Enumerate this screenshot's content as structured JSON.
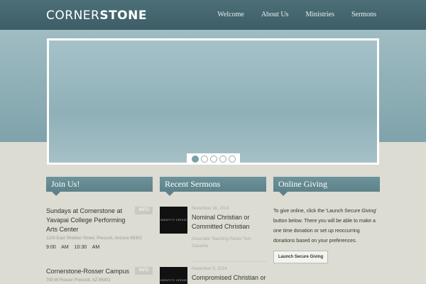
{
  "header": {
    "logo_light": "CORNER",
    "logo_bold": "STONE",
    "nav": [
      "Welcome",
      "About Us",
      "Ministries",
      "Sermons"
    ]
  },
  "slider": {
    "dot_count": 5,
    "active_dot": 1
  },
  "join": {
    "heading": "Join Us!",
    "entries": [
      {
        "title": "Sundays at Cornerstone at Yavapai College Performing Arts Center",
        "info": "INFO",
        "address": "1100 East Sheldon Street, Prescott, Arizona 86301",
        "times": "9:00 AM 10:30 AM"
      },
      {
        "title": "Cornerstone-Rosser Campus",
        "info": "INFO",
        "address": "700 W Rosser Prescott, AZ 86301"
      }
    ]
  },
  "sermons": {
    "heading": "Recent Sermons",
    "items": [
      {
        "thumb_text": "IDENTITY CRISIS",
        "date": "November 16, 2014",
        "title": "Nominal Christian or Committed Christian",
        "speaker": "Associate Teaching Pastor Tom Garasha"
      },
      {
        "thumb_text": "IDENTITY CRISIS",
        "date": "November 9, 2014",
        "title": "Compromised Christian or"
      }
    ]
  },
  "giving": {
    "heading": "Online Giving",
    "text": "To give online, click the 'Launch Secure Giving' button below. There you will be able to make a one time donation or set up reoccurring donations based on your preferences.",
    "button": "Launch Secure Giving"
  }
}
